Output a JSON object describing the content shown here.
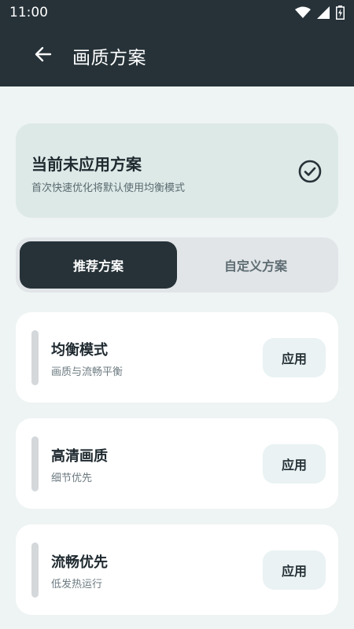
{
  "status_bar": {
    "time": "11:00"
  },
  "app_bar": {
    "title": "画质方案"
  },
  "status_card": {
    "title": "当前未应用方案",
    "subtitle": "首次快速优化将默认使用均衡模式"
  },
  "tabs": [
    {
      "label": "推荐方案",
      "active": true
    },
    {
      "label": "自定义方案",
      "active": false
    }
  ],
  "plans": [
    {
      "name": "均衡模式",
      "desc": "画质与流畅平衡",
      "action": "应用"
    },
    {
      "name": "高清画质",
      "desc": "细节优先",
      "action": "应用"
    },
    {
      "name": "流畅优先",
      "desc": "低发热运行",
      "action": "应用"
    }
  ],
  "colors": {
    "dark": "#263238",
    "background": "#eef3f3",
    "status_card": "#dde9e7",
    "apply_button": "#eaf2f3"
  }
}
